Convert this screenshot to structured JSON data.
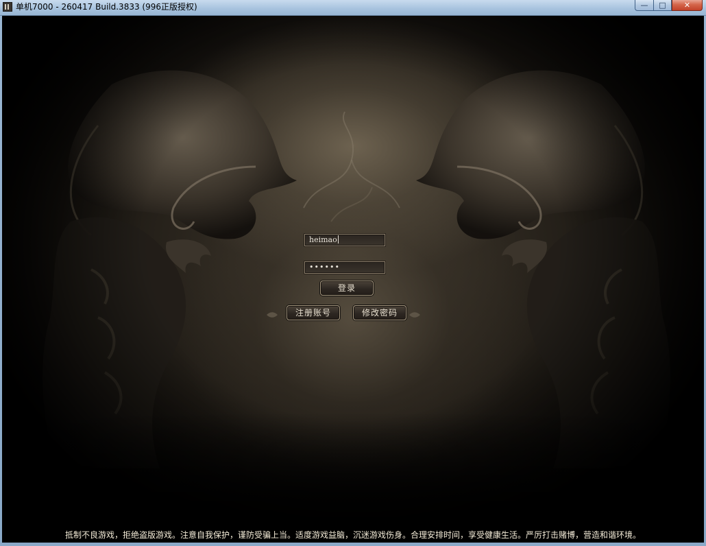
{
  "window": {
    "title": "单机7000 - 260417 Build.3833 (996正版授权)",
    "icon": "app-icon",
    "controls": {
      "minimize": "—",
      "maximize": "□",
      "close": "✕"
    }
  },
  "login": {
    "username_value": "heimao",
    "password_value": "••••••",
    "login_button": "登录",
    "register_button": "注册账号",
    "change_password_button": "修改密码"
  },
  "footer": {
    "notice": "抵制不良游戏，拒绝盗版游戏。注意自我保护，谨防受骗上当。适度游戏益脑，沉迷游戏伤身。合理安排时间，享受健康生活。严厉打击赌博，营造和谐环境。"
  },
  "colors": {
    "background": "#16130f",
    "text": "#e7dfcf",
    "field_border": "#8a7d6a",
    "titlebar": "#a9c4df"
  }
}
